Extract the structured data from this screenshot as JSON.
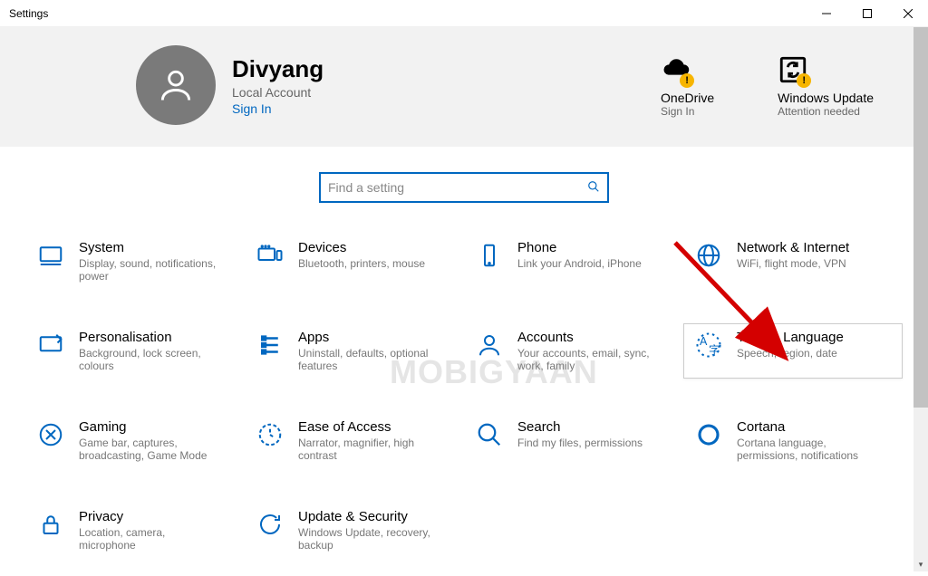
{
  "window": {
    "title": "Settings"
  },
  "user": {
    "name": "Divyang",
    "account_type": "Local Account",
    "signin_label": "Sign In"
  },
  "header_status": {
    "onedrive": {
      "title": "OneDrive",
      "sub": "Sign In"
    },
    "update": {
      "title": "Windows Update",
      "sub": "Attention needed"
    }
  },
  "search": {
    "placeholder": "Find a setting"
  },
  "tiles": {
    "system": {
      "title": "System",
      "desc": "Display, sound, notifications, power"
    },
    "devices": {
      "title": "Devices",
      "desc": "Bluetooth, printers, mouse"
    },
    "phone": {
      "title": "Phone",
      "desc": "Link your Android, iPhone"
    },
    "network": {
      "title": "Network & Internet",
      "desc": "WiFi, flight mode, VPN"
    },
    "personalisation": {
      "title": "Personalisation",
      "desc": "Background, lock screen, colours"
    },
    "apps": {
      "title": "Apps",
      "desc": "Uninstall, defaults, optional features"
    },
    "accounts": {
      "title": "Accounts",
      "desc": "Your accounts, email, sync, work, family"
    },
    "time": {
      "title": "Time & Language",
      "desc": "Speech, region, date"
    },
    "gaming": {
      "title": "Gaming",
      "desc": "Game bar, captures, broadcasting, Game Mode"
    },
    "ease": {
      "title": "Ease of Access",
      "desc": "Narrator, magnifier, high contrast"
    },
    "search_tile": {
      "title": "Search",
      "desc": "Find my files, permissions"
    },
    "cortana": {
      "title": "Cortana",
      "desc": "Cortana language, permissions, notifications"
    },
    "privacy": {
      "title": "Privacy",
      "desc": "Location, camera, microphone"
    },
    "update": {
      "title": "Update & Security",
      "desc": "Windows Update, recovery, backup"
    }
  },
  "watermark": "MOBIGYAAN"
}
